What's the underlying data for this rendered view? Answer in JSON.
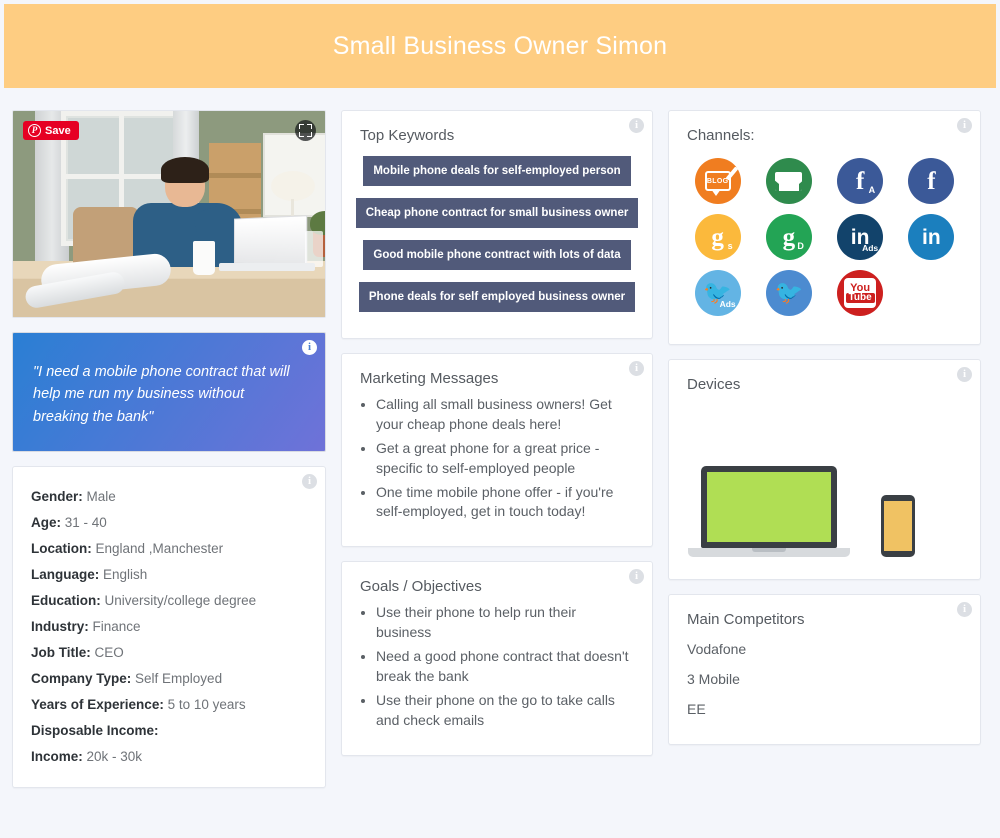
{
  "header": {
    "title": "Small Business Owner Simon"
  },
  "photo": {
    "pin_save_label": "Save",
    "pin_icon": "pinterest-icon",
    "expand_icon": "expand-icon",
    "alt": "man working on laptop at desk"
  },
  "quote": {
    "text": "\"I need a mobile phone contract that will help me run my business without breaking the bank\""
  },
  "demographics": {
    "rows": [
      {
        "label": "Gender:",
        "value": "Male"
      },
      {
        "label": "Age:",
        "value": "31 - 40"
      },
      {
        "label": "Location:",
        "value": "England ,Manchester"
      },
      {
        "label": "Language:",
        "value": "English"
      },
      {
        "label": "Education:",
        "value": "University/college degree"
      },
      {
        "label": "Industry:",
        "value": "Finance"
      },
      {
        "label": "Job Title:",
        "value": "CEO"
      },
      {
        "label": "Company Type:",
        "value": "Self Employed"
      },
      {
        "label": "Years of Experience:",
        "value": "5 to 10 years"
      },
      {
        "label": "Disposable Income:",
        "value": ""
      },
      {
        "label": "Income:",
        "value": "20k - 30k"
      }
    ]
  },
  "keywords": {
    "title": "Top Keywords",
    "items": [
      "Mobile phone deals for self-employed person",
      "Cheap phone contract for small business owner",
      "Good mobile phone contract with lots of data",
      "Phone deals for self employed business owner"
    ],
    "chip_color": "#515a7a"
  },
  "marketing": {
    "title": "Marketing Messages",
    "items": [
      "Calling all small business owners! Get your cheap phone deals here!",
      "Get a great phone for a great price - specific to self-employed people",
      "One time mobile phone offer - if you're self-employed, get in touch today!"
    ]
  },
  "goals": {
    "title": "Goals / Objectives",
    "items": [
      "Use their phone to help run their business",
      "Need a good phone contract that doesn't break the bank",
      "Use their phone on the go to take calls and check emails"
    ]
  },
  "channels": {
    "title": "Channels:",
    "items": [
      {
        "name": "blog-icon",
        "label": "Blog",
        "color": "#f07d20",
        "kind": "blog",
        "glyph": "BLOG",
        "sub": ""
      },
      {
        "name": "email-icon",
        "label": "Email",
        "color": "#2f8b4d",
        "kind": "mail",
        "glyph": "",
        "sub": ""
      },
      {
        "name": "facebook-ads-icon",
        "label": "Facebook Ads",
        "color": "#3b5998",
        "kind": "fb",
        "glyph": "f",
        "sub": "A"
      },
      {
        "name": "facebook-icon",
        "label": "Facebook",
        "color": "#3b5998",
        "kind": "fb",
        "glyph": "f",
        "sub": ""
      },
      {
        "name": "google-search-icon",
        "label": "Google Search",
        "color": "#fbb93c",
        "kind": "g",
        "glyph": "g",
        "sub": "s"
      },
      {
        "name": "google-display-icon",
        "label": "Google Display",
        "color": "#23a455",
        "kind": "g",
        "glyph": "g",
        "sub": "D"
      },
      {
        "name": "linkedin-ads-icon",
        "label": "LinkedIn Ads",
        "color": "#12436b",
        "kind": "li",
        "glyph": "in",
        "sub": "Ads"
      },
      {
        "name": "linkedin-icon",
        "label": "LinkedIn",
        "color": "#1b7fbe",
        "kind": "li",
        "glyph": "in",
        "sub": ""
      },
      {
        "name": "twitter-ads-icon",
        "label": "Twitter Ads",
        "color": "#63b4e4",
        "kind": "tw",
        "glyph": "",
        "sub": "Ads"
      },
      {
        "name": "twitter-icon",
        "label": "Twitter",
        "color": "#4c8bd0",
        "kind": "tw",
        "glyph": "",
        "sub": ""
      },
      {
        "name": "youtube-icon",
        "label": "YouTube",
        "color": "#cd201f",
        "kind": "yt",
        "glyph": "You",
        "sub": "Tube"
      }
    ]
  },
  "devices": {
    "title": "Devices",
    "items": [
      {
        "name": "laptop",
        "screen_color": "#b0de54"
      },
      {
        "name": "smartphone",
        "screen_color": "#f0c263"
      }
    ]
  },
  "competitors": {
    "title": "Main Competitors",
    "items": [
      "Vodafone",
      "3 Mobile",
      "EE"
    ]
  },
  "info_tooltip": "i",
  "theme": {
    "header_bg": "#fecd82",
    "page_bg": "#f4f6fb",
    "card_bg": "#ffffff",
    "quote_gradient_start": "#2a7fd4",
    "quote_gradient_end": "#6f72d8"
  }
}
